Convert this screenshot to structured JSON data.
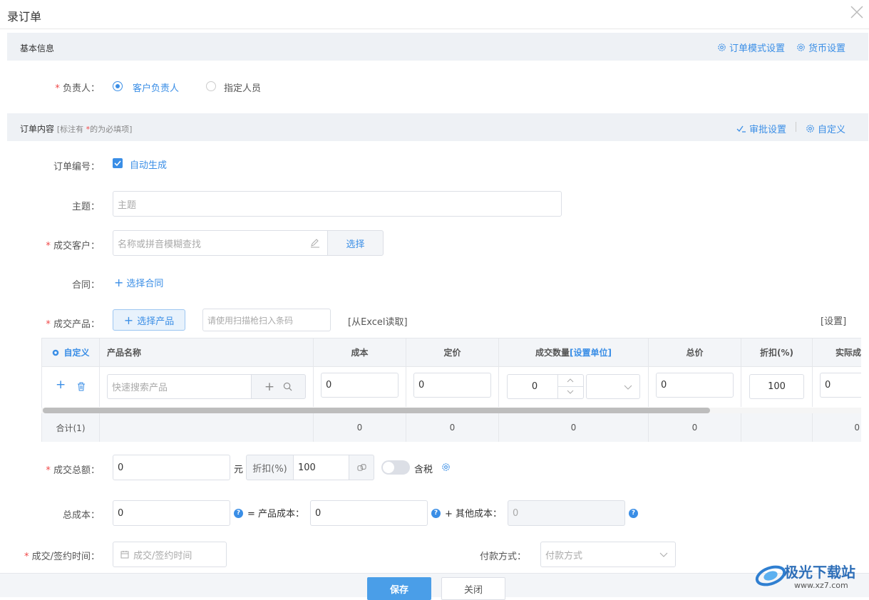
{
  "window": {
    "title": "录订单"
  },
  "basic": {
    "section_title": "基本信息",
    "order_mode_link": "订单模式设置",
    "currency_link": "货币设置",
    "owner_label": "负责人：",
    "owner_options": [
      "客户负责人",
      "指定人员"
    ],
    "owner_selected": "客户负责人"
  },
  "content": {
    "section_title": "订单内容",
    "section_hint_pre": "[标注有",
    "section_hint_star": "*",
    "section_hint_post": "的为必填项]",
    "approval_link": "审批设置",
    "custom_link": "自定义"
  },
  "form": {
    "order_no_label": "订单编号：",
    "auto_generate": "自动生成",
    "subject_label": "主题：",
    "subject_placeholder": "主题",
    "customer_label": "成交客户：",
    "customer_placeholder": "名称或拼音模糊查找",
    "customer_select_button": "选择",
    "contract_label": "合同：",
    "contract_select": "选择合同",
    "product_label": "成交产品：",
    "product_select_button": "选择产品",
    "barcode_placeholder": "请使用扫描枪扫入条码",
    "excel_link": "[从Excel读取]",
    "settings_link": "[设置]",
    "total_amount_label": "成交总额：",
    "total_amount_value": "0",
    "currency_unit": "元",
    "discount_label": "折扣(%)",
    "discount_value": "100",
    "tax_label": "含税",
    "total_cost_label": "总成本：",
    "total_cost_value": "0",
    "product_cost_label": "= 产品成本：",
    "product_cost_value": "0",
    "other_cost_label": "+ 其他成本：",
    "other_cost_value": "0",
    "deal_time_label": "成交/签约时间：",
    "deal_time_placeholder": "成交/签约时间",
    "payment_label": "付款方式：",
    "payment_placeholder": "付款方式"
  },
  "table": {
    "custom_header": "自定义",
    "columns": [
      "产品名称",
      "成本",
      "定价",
      "成交数量",
      "总价",
      "折扣(%)",
      "实际成"
    ],
    "quantity_unit_link": "[设置单位]",
    "row": {
      "product_placeholder": "快速搜索产品",
      "cost": "0",
      "price": "0",
      "quantity": "0",
      "total": "0",
      "discount": "100",
      "actual": "0"
    },
    "footer": {
      "label": "合计(1)",
      "cost": "0",
      "price": "0",
      "quantity": "0",
      "total": "0",
      "actual": "0"
    }
  },
  "footer": {
    "save": "保存",
    "close": "关闭"
  },
  "watermark": {
    "text": "极光下载站",
    "url": "www.xz7.com"
  },
  "colors": {
    "accent": "#3a8ee6",
    "required": "#f04848",
    "section_bg": "#eef1f5"
  }
}
